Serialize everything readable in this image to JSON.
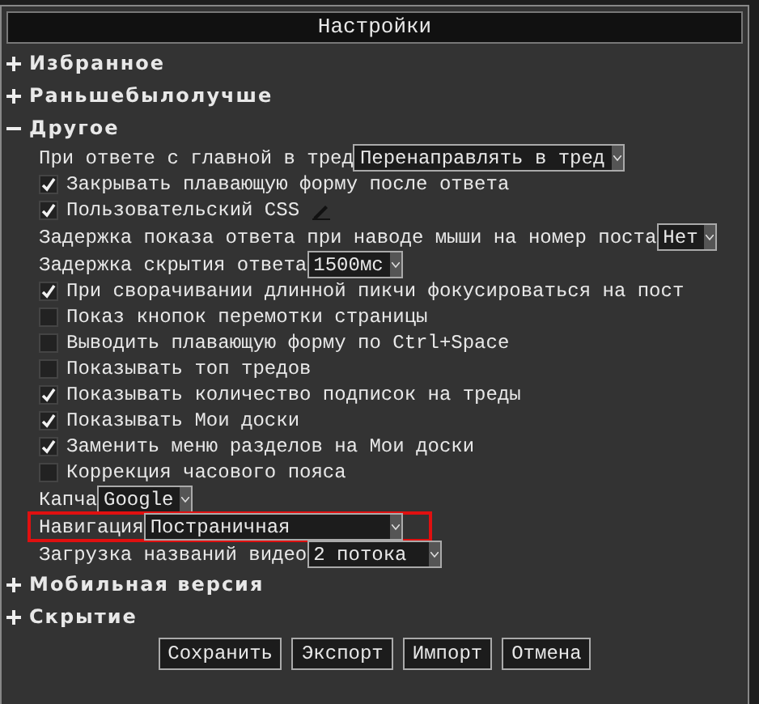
{
  "window": {
    "title": "Настройки"
  },
  "sections": [
    {
      "label": "Избранное",
      "expanded": false
    },
    {
      "label": "Раньшебылолучше",
      "expanded": false
    },
    {
      "label": "Другое",
      "expanded": true,
      "items": [
        {
          "kind": "select",
          "label": "При ответе с главной в тред",
          "value": "Перенаправлять в тред"
        },
        {
          "kind": "checkbox",
          "label": "Закрывать плавающую форму после ответа",
          "checked": true
        },
        {
          "kind": "checkbox",
          "label": "Пользовательский CSS",
          "checked": true,
          "editable": true
        },
        {
          "kind": "select",
          "label": "Задержка показа ответа при наводе мыши на номер поста",
          "value": "Нет"
        },
        {
          "kind": "select",
          "label": "Задержка скрытия ответа",
          "value": "1500мс"
        },
        {
          "kind": "checkbox",
          "label": "При сворачивании длинной пикчи фокусироваться на пост",
          "checked": true
        },
        {
          "kind": "checkbox",
          "label": "Показ кнопок перемотки страницы",
          "checked": false
        },
        {
          "kind": "checkbox",
          "label": "Выводить плавающую форму по Ctrl+Space",
          "checked": false
        },
        {
          "kind": "checkbox",
          "label": "Показывать топ тредов",
          "checked": false
        },
        {
          "kind": "checkbox",
          "label": "Показывать количество подписок на треды",
          "checked": true
        },
        {
          "kind": "checkbox",
          "label": "Показывать Мои доски",
          "checked": true
        },
        {
          "kind": "checkbox",
          "label": "Заменить меню разделов на Мои доски",
          "checked": true
        },
        {
          "kind": "checkbox",
          "label": "Коррекция часового пояса",
          "checked": false
        },
        {
          "kind": "select",
          "label": "Капча",
          "value": "Google"
        },
        {
          "kind": "select",
          "label": "Навигация",
          "value": "Постраничная",
          "highlighted": true
        },
        {
          "kind": "select",
          "label": "Загрузка названий видео",
          "value": "2 потока"
        }
      ]
    },
    {
      "label": "Мобильная версия",
      "expanded": false
    },
    {
      "label": "Скрытие",
      "expanded": false
    }
  ],
  "buttons": [
    "Сохранить",
    "Экспорт",
    "Импорт",
    "Отмена"
  ]
}
